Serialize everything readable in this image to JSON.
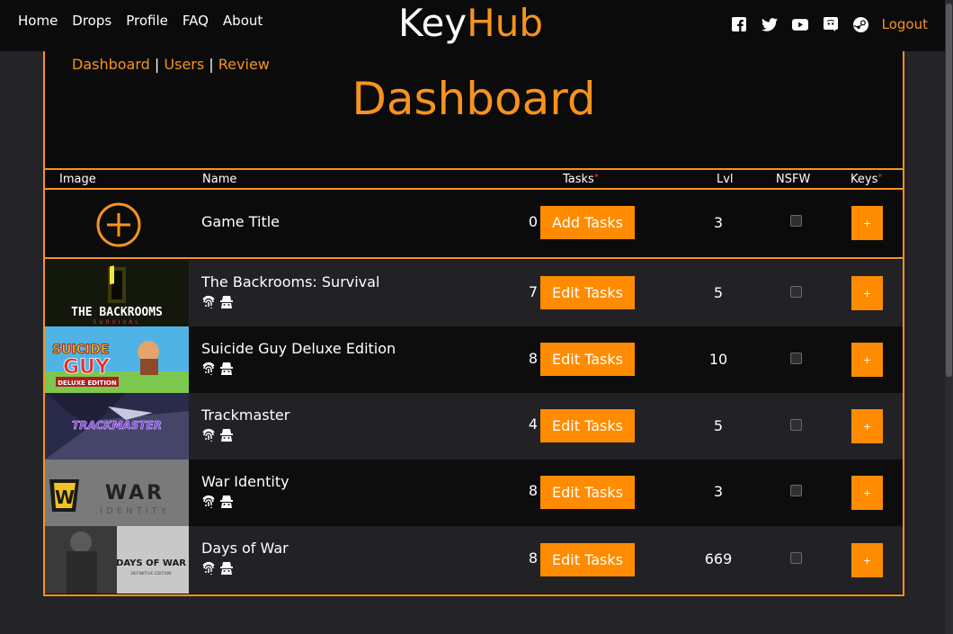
{
  "nav": {
    "links": [
      "Home",
      "Drops",
      "Profile",
      "FAQ",
      "About"
    ],
    "brand_left": "Key",
    "brand_right": "Hub",
    "logout": "Logout",
    "social_icons": [
      "facebook-icon",
      "twitter-icon",
      "youtube-icon",
      "discord-icon",
      "steam-icon"
    ]
  },
  "breadcrumb": {
    "items": [
      "Dashboard",
      "Users",
      "Review"
    ],
    "separator": "|"
  },
  "page_title": "Dashboard",
  "table": {
    "headers": {
      "image": "Image",
      "name": "Name",
      "tasks": "Tasks",
      "lvl": "Lvl",
      "nsfw": "NSFW",
      "keys": "Keys"
    },
    "required_mark": "*",
    "new_row": {
      "name": "Game Title",
      "tasks": "0",
      "button": "Add Tasks",
      "lvl": "3",
      "key_button": "+"
    },
    "rows": [
      {
        "name": "The Backrooms: Survival",
        "tasks": "7",
        "button": "Edit Tasks",
        "lvl": "5",
        "key_button": "+",
        "nsfw": false
      },
      {
        "name": "Suicide Guy Deluxe Edition",
        "tasks": "8",
        "button": "Edit Tasks",
        "lvl": "10",
        "key_button": "+",
        "nsfw": false
      },
      {
        "name": "Trackmaster",
        "tasks": "4",
        "button": "Edit Tasks",
        "lvl": "5",
        "key_button": "+",
        "nsfw": false
      },
      {
        "name": "War Identity",
        "tasks": "8",
        "button": "Edit Tasks",
        "lvl": "3",
        "key_button": "+",
        "nsfw": false
      },
      {
        "name": "Days of War",
        "tasks": "8",
        "button": "Edit Tasks",
        "lvl": "669",
        "key_button": "+",
        "nsfw": false
      }
    ],
    "thumb_texts": {
      "backrooms": [
        "THE BACKROOMS",
        "SURVIVAL"
      ],
      "suicide": [
        "SUICIDE",
        "GUY",
        "DELUXE EDITION"
      ],
      "trackmaster": [
        "TRACKMASTER"
      ],
      "war": [
        "WAR",
        "IDENTITY"
      ],
      "days": [
        "DAYS OF WAR",
        "DEFINITIVE EDITION"
      ]
    }
  },
  "colors": {
    "accent": "#f7931e",
    "button": "#ff8c00",
    "required": "#e03c3c"
  }
}
